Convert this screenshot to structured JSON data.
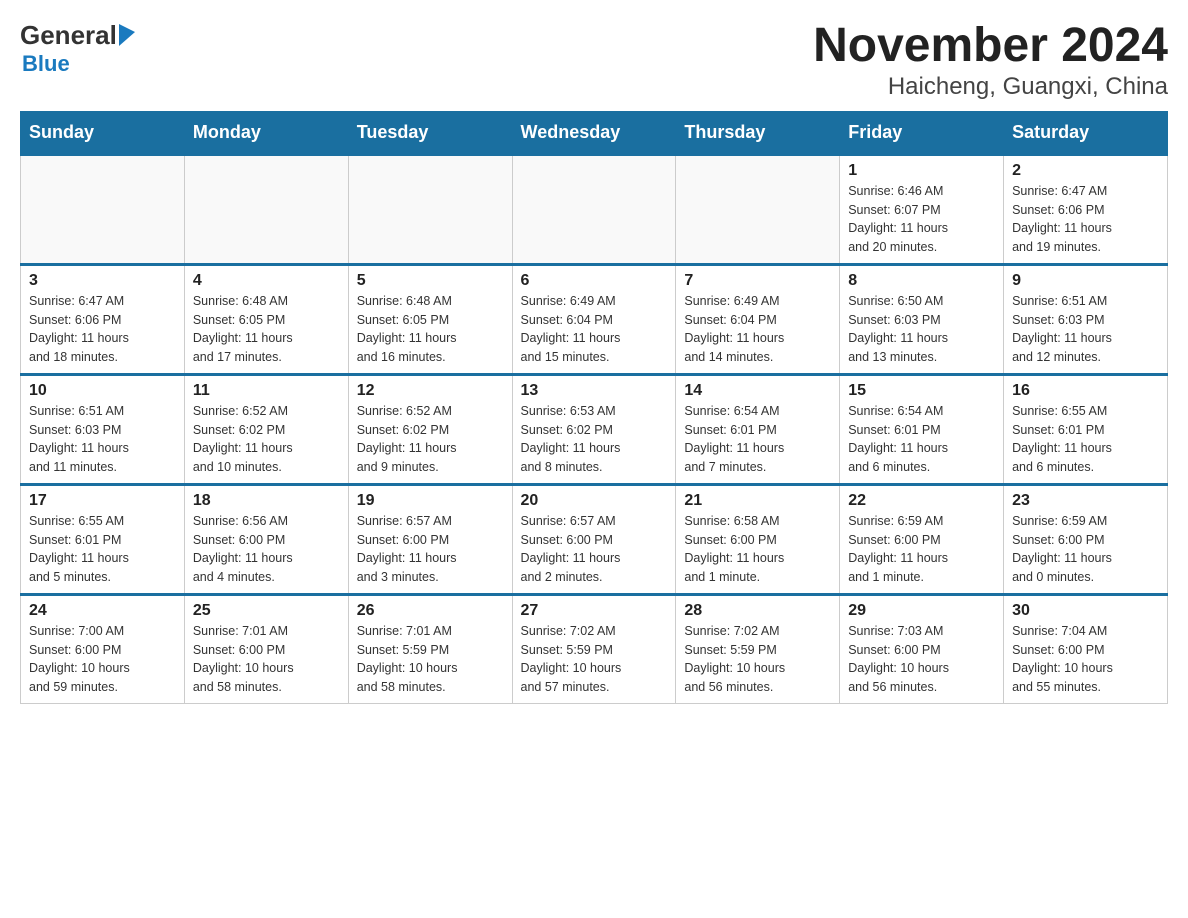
{
  "header": {
    "logo_line1": "General",
    "logo_line2": "Blue",
    "title": "November 2024",
    "subtitle": "Haicheng, Guangxi, China"
  },
  "weekdays": [
    "Sunday",
    "Monday",
    "Tuesday",
    "Wednesday",
    "Thursday",
    "Friday",
    "Saturday"
  ],
  "weeks": [
    [
      {
        "day": "",
        "info": ""
      },
      {
        "day": "",
        "info": ""
      },
      {
        "day": "",
        "info": ""
      },
      {
        "day": "",
        "info": ""
      },
      {
        "day": "",
        "info": ""
      },
      {
        "day": "1",
        "info": "Sunrise: 6:46 AM\nSunset: 6:07 PM\nDaylight: 11 hours\nand 20 minutes."
      },
      {
        "day": "2",
        "info": "Sunrise: 6:47 AM\nSunset: 6:06 PM\nDaylight: 11 hours\nand 19 minutes."
      }
    ],
    [
      {
        "day": "3",
        "info": "Sunrise: 6:47 AM\nSunset: 6:06 PM\nDaylight: 11 hours\nand 18 minutes."
      },
      {
        "day": "4",
        "info": "Sunrise: 6:48 AM\nSunset: 6:05 PM\nDaylight: 11 hours\nand 17 minutes."
      },
      {
        "day": "5",
        "info": "Sunrise: 6:48 AM\nSunset: 6:05 PM\nDaylight: 11 hours\nand 16 minutes."
      },
      {
        "day": "6",
        "info": "Sunrise: 6:49 AM\nSunset: 6:04 PM\nDaylight: 11 hours\nand 15 minutes."
      },
      {
        "day": "7",
        "info": "Sunrise: 6:49 AM\nSunset: 6:04 PM\nDaylight: 11 hours\nand 14 minutes."
      },
      {
        "day": "8",
        "info": "Sunrise: 6:50 AM\nSunset: 6:03 PM\nDaylight: 11 hours\nand 13 minutes."
      },
      {
        "day": "9",
        "info": "Sunrise: 6:51 AM\nSunset: 6:03 PM\nDaylight: 11 hours\nand 12 minutes."
      }
    ],
    [
      {
        "day": "10",
        "info": "Sunrise: 6:51 AM\nSunset: 6:03 PM\nDaylight: 11 hours\nand 11 minutes."
      },
      {
        "day": "11",
        "info": "Sunrise: 6:52 AM\nSunset: 6:02 PM\nDaylight: 11 hours\nand 10 minutes."
      },
      {
        "day": "12",
        "info": "Sunrise: 6:52 AM\nSunset: 6:02 PM\nDaylight: 11 hours\nand 9 minutes."
      },
      {
        "day": "13",
        "info": "Sunrise: 6:53 AM\nSunset: 6:02 PM\nDaylight: 11 hours\nand 8 minutes."
      },
      {
        "day": "14",
        "info": "Sunrise: 6:54 AM\nSunset: 6:01 PM\nDaylight: 11 hours\nand 7 minutes."
      },
      {
        "day": "15",
        "info": "Sunrise: 6:54 AM\nSunset: 6:01 PM\nDaylight: 11 hours\nand 6 minutes."
      },
      {
        "day": "16",
        "info": "Sunrise: 6:55 AM\nSunset: 6:01 PM\nDaylight: 11 hours\nand 6 minutes."
      }
    ],
    [
      {
        "day": "17",
        "info": "Sunrise: 6:55 AM\nSunset: 6:01 PM\nDaylight: 11 hours\nand 5 minutes."
      },
      {
        "day": "18",
        "info": "Sunrise: 6:56 AM\nSunset: 6:00 PM\nDaylight: 11 hours\nand 4 minutes."
      },
      {
        "day": "19",
        "info": "Sunrise: 6:57 AM\nSunset: 6:00 PM\nDaylight: 11 hours\nand 3 minutes."
      },
      {
        "day": "20",
        "info": "Sunrise: 6:57 AM\nSunset: 6:00 PM\nDaylight: 11 hours\nand 2 minutes."
      },
      {
        "day": "21",
        "info": "Sunrise: 6:58 AM\nSunset: 6:00 PM\nDaylight: 11 hours\nand 1 minute."
      },
      {
        "day": "22",
        "info": "Sunrise: 6:59 AM\nSunset: 6:00 PM\nDaylight: 11 hours\nand 1 minute."
      },
      {
        "day": "23",
        "info": "Sunrise: 6:59 AM\nSunset: 6:00 PM\nDaylight: 11 hours\nand 0 minutes."
      }
    ],
    [
      {
        "day": "24",
        "info": "Sunrise: 7:00 AM\nSunset: 6:00 PM\nDaylight: 10 hours\nand 59 minutes."
      },
      {
        "day": "25",
        "info": "Sunrise: 7:01 AM\nSunset: 6:00 PM\nDaylight: 10 hours\nand 58 minutes."
      },
      {
        "day": "26",
        "info": "Sunrise: 7:01 AM\nSunset: 5:59 PM\nDaylight: 10 hours\nand 58 minutes."
      },
      {
        "day": "27",
        "info": "Sunrise: 7:02 AM\nSunset: 5:59 PM\nDaylight: 10 hours\nand 57 minutes."
      },
      {
        "day": "28",
        "info": "Sunrise: 7:02 AM\nSunset: 5:59 PM\nDaylight: 10 hours\nand 56 minutes."
      },
      {
        "day": "29",
        "info": "Sunrise: 7:03 AM\nSunset: 6:00 PM\nDaylight: 10 hours\nand 56 minutes."
      },
      {
        "day": "30",
        "info": "Sunrise: 7:04 AM\nSunset: 6:00 PM\nDaylight: 10 hours\nand 55 minutes."
      }
    ]
  ]
}
